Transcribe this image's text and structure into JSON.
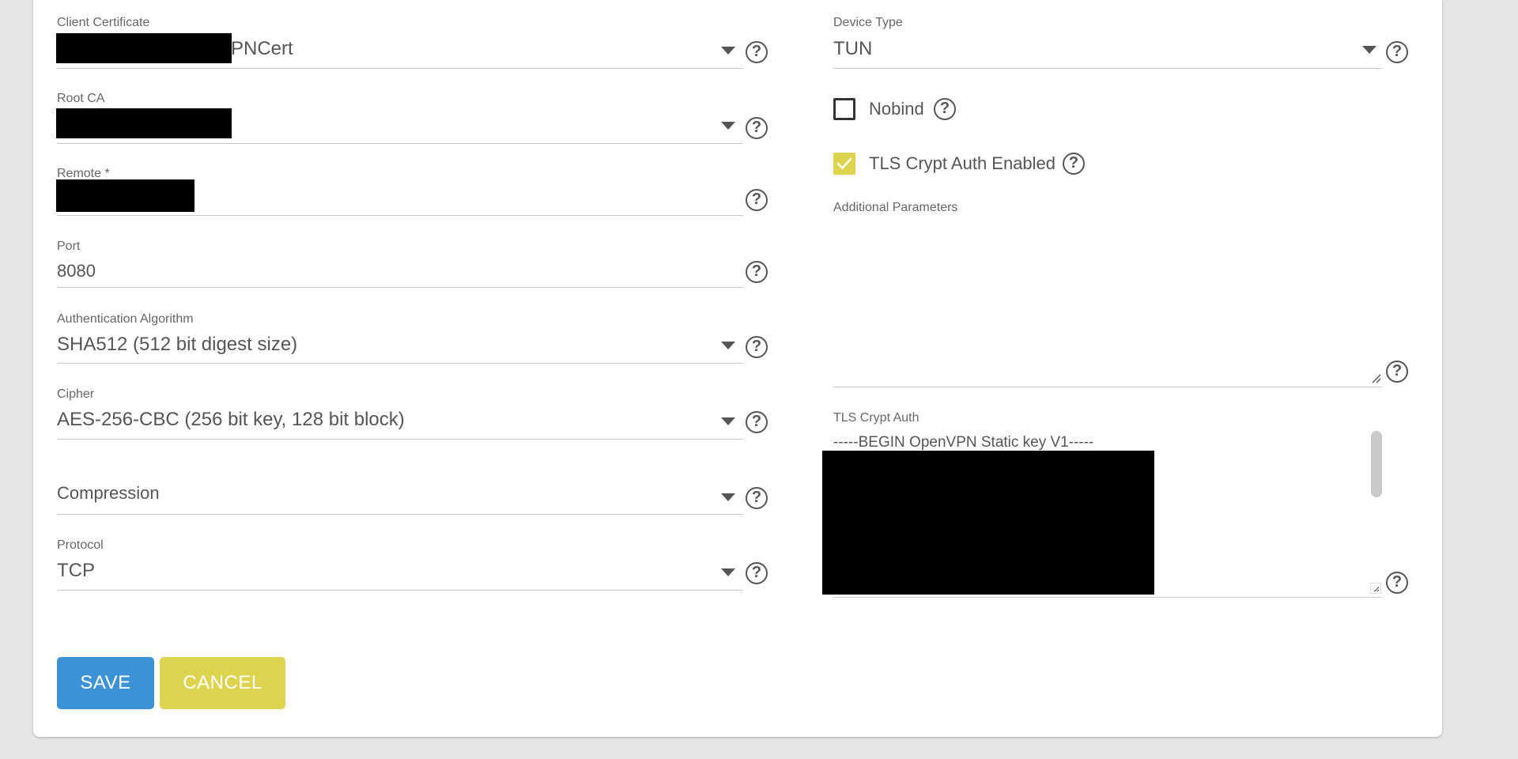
{
  "left_fields": {
    "client_certificate": {
      "label": "Client Certificate",
      "value": "PNCert"
    },
    "root_ca": {
      "label": "Root CA",
      "value": ""
    },
    "remote": {
      "label": "Remote *",
      "value": ""
    },
    "port": {
      "label": "Port",
      "value": "8080"
    },
    "auth_algorithm": {
      "label": "Authentication Algorithm",
      "value": "SHA512 (512 bit digest size)"
    },
    "cipher": {
      "label": "Cipher",
      "value": "AES-256-CBC (256 bit key, 128 bit block)"
    },
    "compression": {
      "label": "",
      "value": "Compression"
    },
    "protocol": {
      "label": "Protocol",
      "value": "TCP"
    }
  },
  "right_fields": {
    "device_type": {
      "label": "Device Type",
      "value": "TUN"
    },
    "nobind": {
      "label": "Nobind",
      "checked": false
    },
    "tls_crypt_auth_enabled": {
      "label": "TLS Crypt Auth Enabled",
      "checked": true
    },
    "additional_parameters": {
      "label": "Additional Parameters",
      "value": ""
    },
    "tls_crypt_auth": {
      "label": "TLS Crypt Auth",
      "value": "-----BEGIN OpenVPN Static key V1-----"
    }
  },
  "help_glyph": "?",
  "buttons": {
    "save": "SAVE",
    "cancel": "CANCEL"
  },
  "colors": {
    "save_button": "#3d91d5",
    "cancel_button": "#dcd44f",
    "checkbox_checked": "#dcd44f"
  },
  "icons": [
    "chevron-down-icon",
    "help-icon",
    "checkmark-icon",
    "resize-grip-icon"
  ]
}
